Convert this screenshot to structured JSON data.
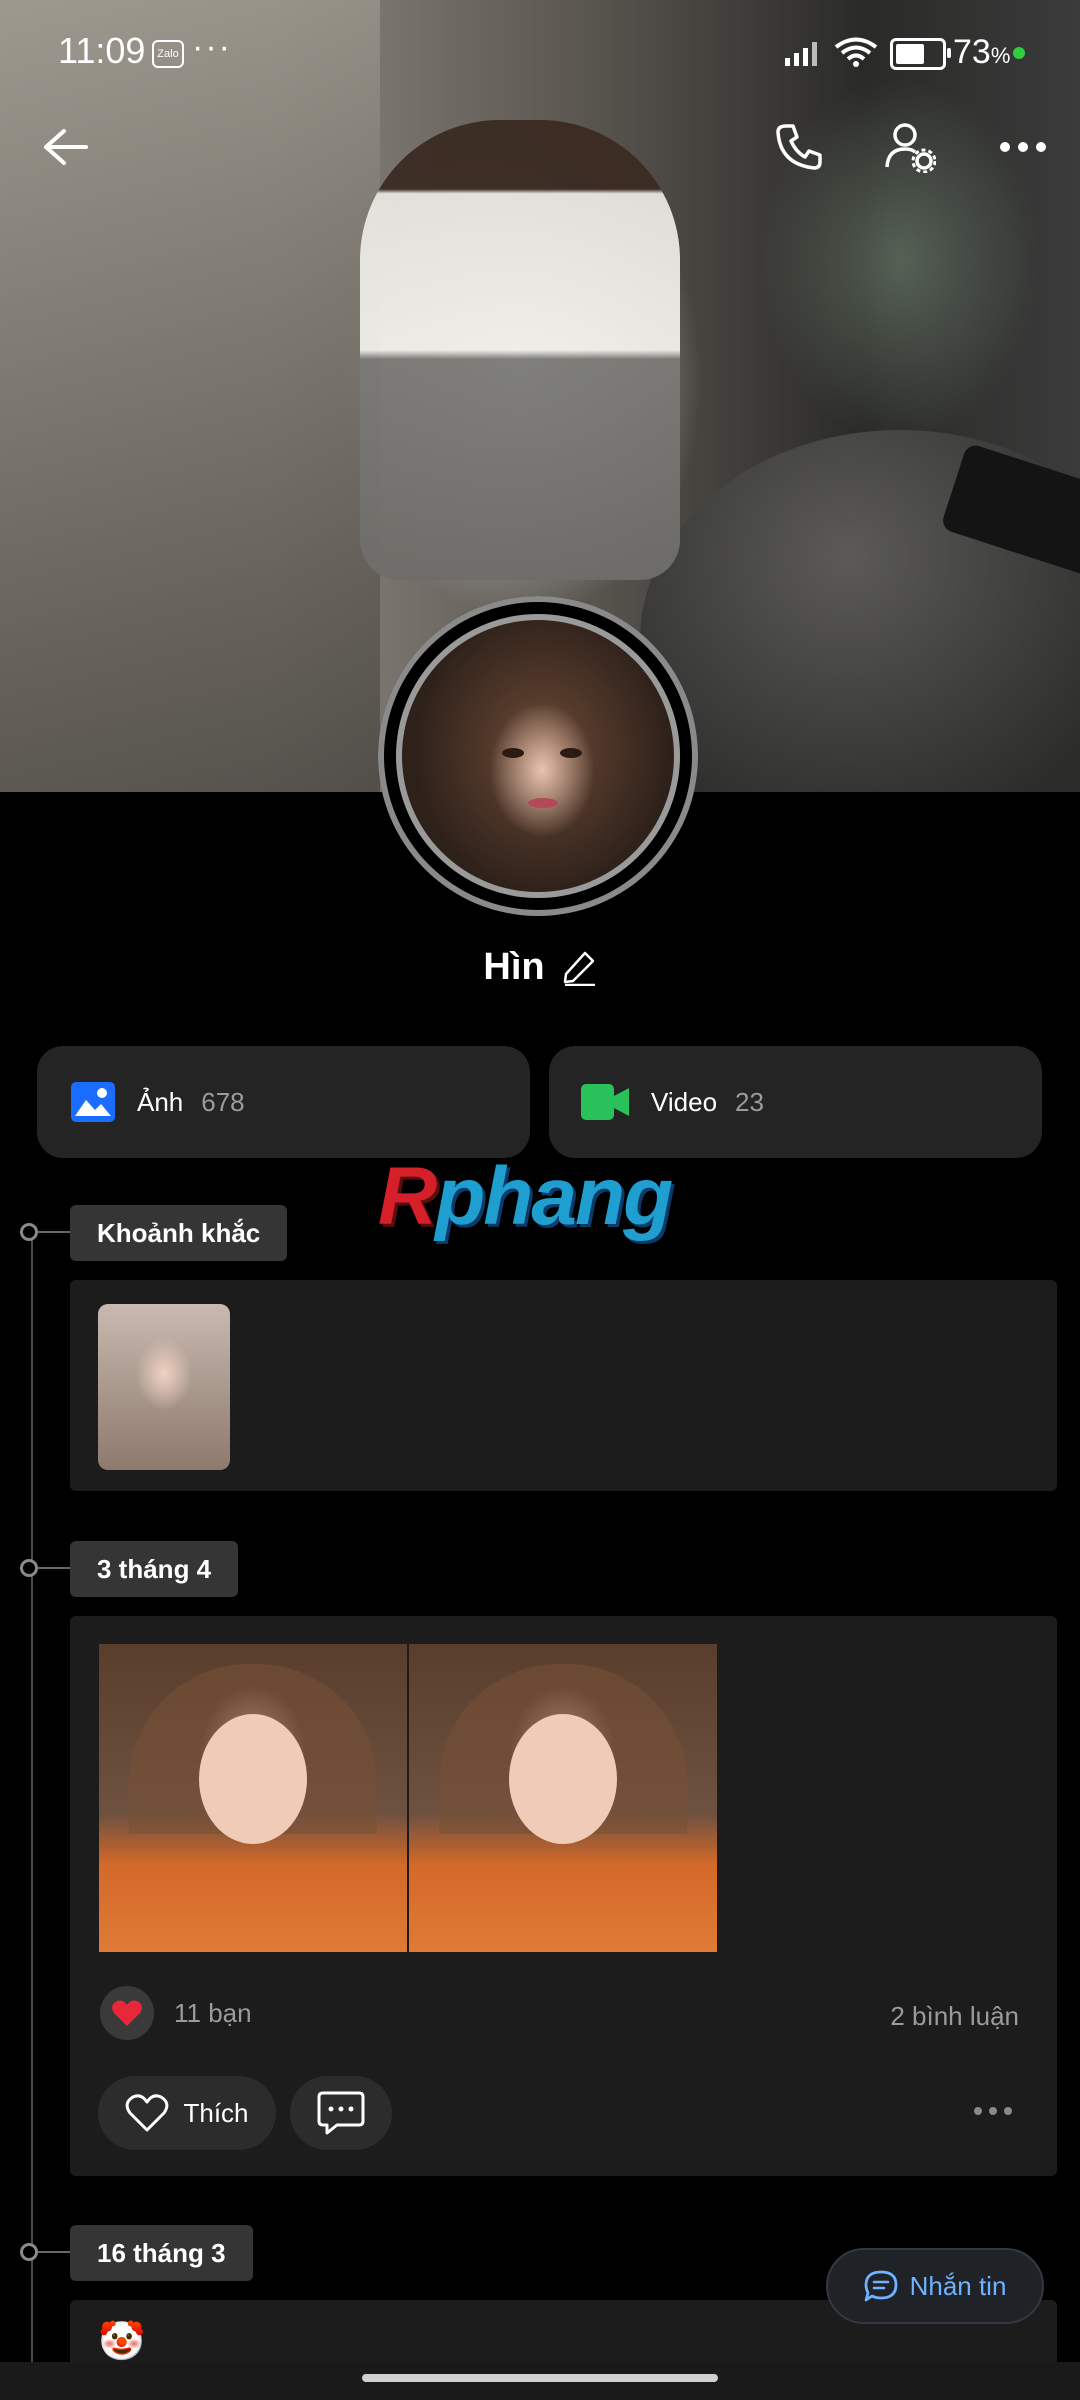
{
  "status_bar": {
    "time": "11:09",
    "app_badge": "Zalo",
    "overflow": "···",
    "battery_pct": "73",
    "battery_pct_unit": "%",
    "battery_level": 0.73
  },
  "top_bar": {
    "icons": [
      "back-arrow-icon",
      "phone-call-icon",
      "profile-settings-icon",
      "more-options-icon"
    ]
  },
  "profile": {
    "name": "Hìn"
  },
  "media": {
    "photos_label": "Ảnh",
    "photos_count": "678",
    "video_label": "Video",
    "video_count": "23",
    "photo_icon_color": "#1a6dff",
    "video_icon_color": "#29c25a"
  },
  "watermark": {
    "first": "R",
    "rest": "phang"
  },
  "timeline": {
    "moments_label": "Khoảnh khắc",
    "post1": {
      "date": "3 tháng 4",
      "reactions": "11 bạn",
      "comments": "2 bình luận",
      "like_label": "Thích"
    },
    "post2": {
      "date": "16 tháng 3",
      "emoji": "🤡"
    }
  },
  "message_button": {
    "label": "Nhắn tin",
    "color": "#6fb2ff"
  }
}
